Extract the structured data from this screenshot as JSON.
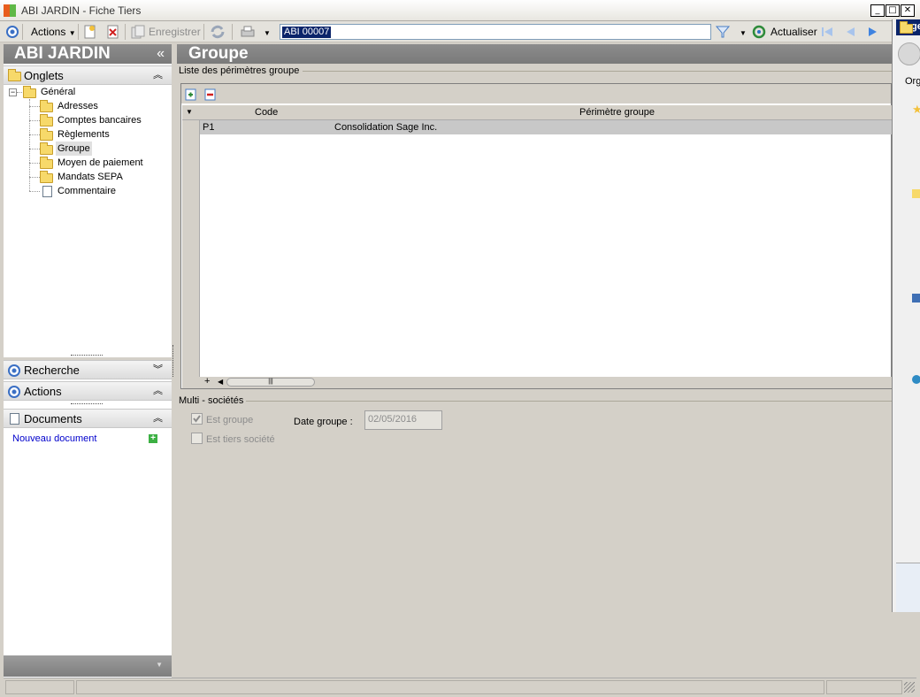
{
  "window": {
    "title": "ABI JARDIN - Fiche Tiers"
  },
  "toolbar": {
    "actions_label": "Actions",
    "save_label": "Enregistrer",
    "search_value": "ABI 00007",
    "refresh_label": "Actualiser"
  },
  "left_panel": {
    "title": "ABI JARDIN",
    "collapse_glyph": "«",
    "tabs_section": "Onglets",
    "tree": {
      "root": "Général",
      "items": [
        {
          "label": "Adresses",
          "icon": "folder-icon"
        },
        {
          "label": "Comptes bancaires",
          "icon": "folder-icon"
        },
        {
          "label": "Règlements",
          "icon": "folder-icon"
        },
        {
          "label": "Groupe",
          "icon": "folder-open-icon",
          "selected": true
        },
        {
          "label": "Moyen de paiement",
          "icon": "folder-icon"
        },
        {
          "label": "Mandats SEPA",
          "icon": "folder-icon"
        },
        {
          "label": "Commentaire",
          "icon": "document-icon"
        }
      ]
    },
    "search_section": "Recherche",
    "actions_section": "Actions",
    "documents_section": "Documents",
    "new_document_link": "Nouveau document"
  },
  "main": {
    "header": "Groupe",
    "list_group_title": "Liste des périmètres groupe",
    "grid": {
      "columns": [
        "Code",
        "Périmètre groupe"
      ],
      "rows": [
        {
          "code": "P1",
          "perimetre": "Consolidation Sage Inc."
        }
      ],
      "add_row_glyph": "+"
    },
    "multi_group_title": "Multi - sociétés",
    "est_groupe_label": "Est groupe",
    "est_groupe_checked": true,
    "date_groupe_label": "Date groupe :",
    "date_groupe_value": "02/05/2016",
    "est_tiers_societe_label": "Est tiers société",
    "est_tiers_societe_checked": false
  },
  "right_window": {
    "partial_label": "Org",
    "partial_title": "ge"
  },
  "colors": {
    "header_gray": "#838383",
    "selection_blue": "#0a246a",
    "link_blue": "#0000cc"
  }
}
